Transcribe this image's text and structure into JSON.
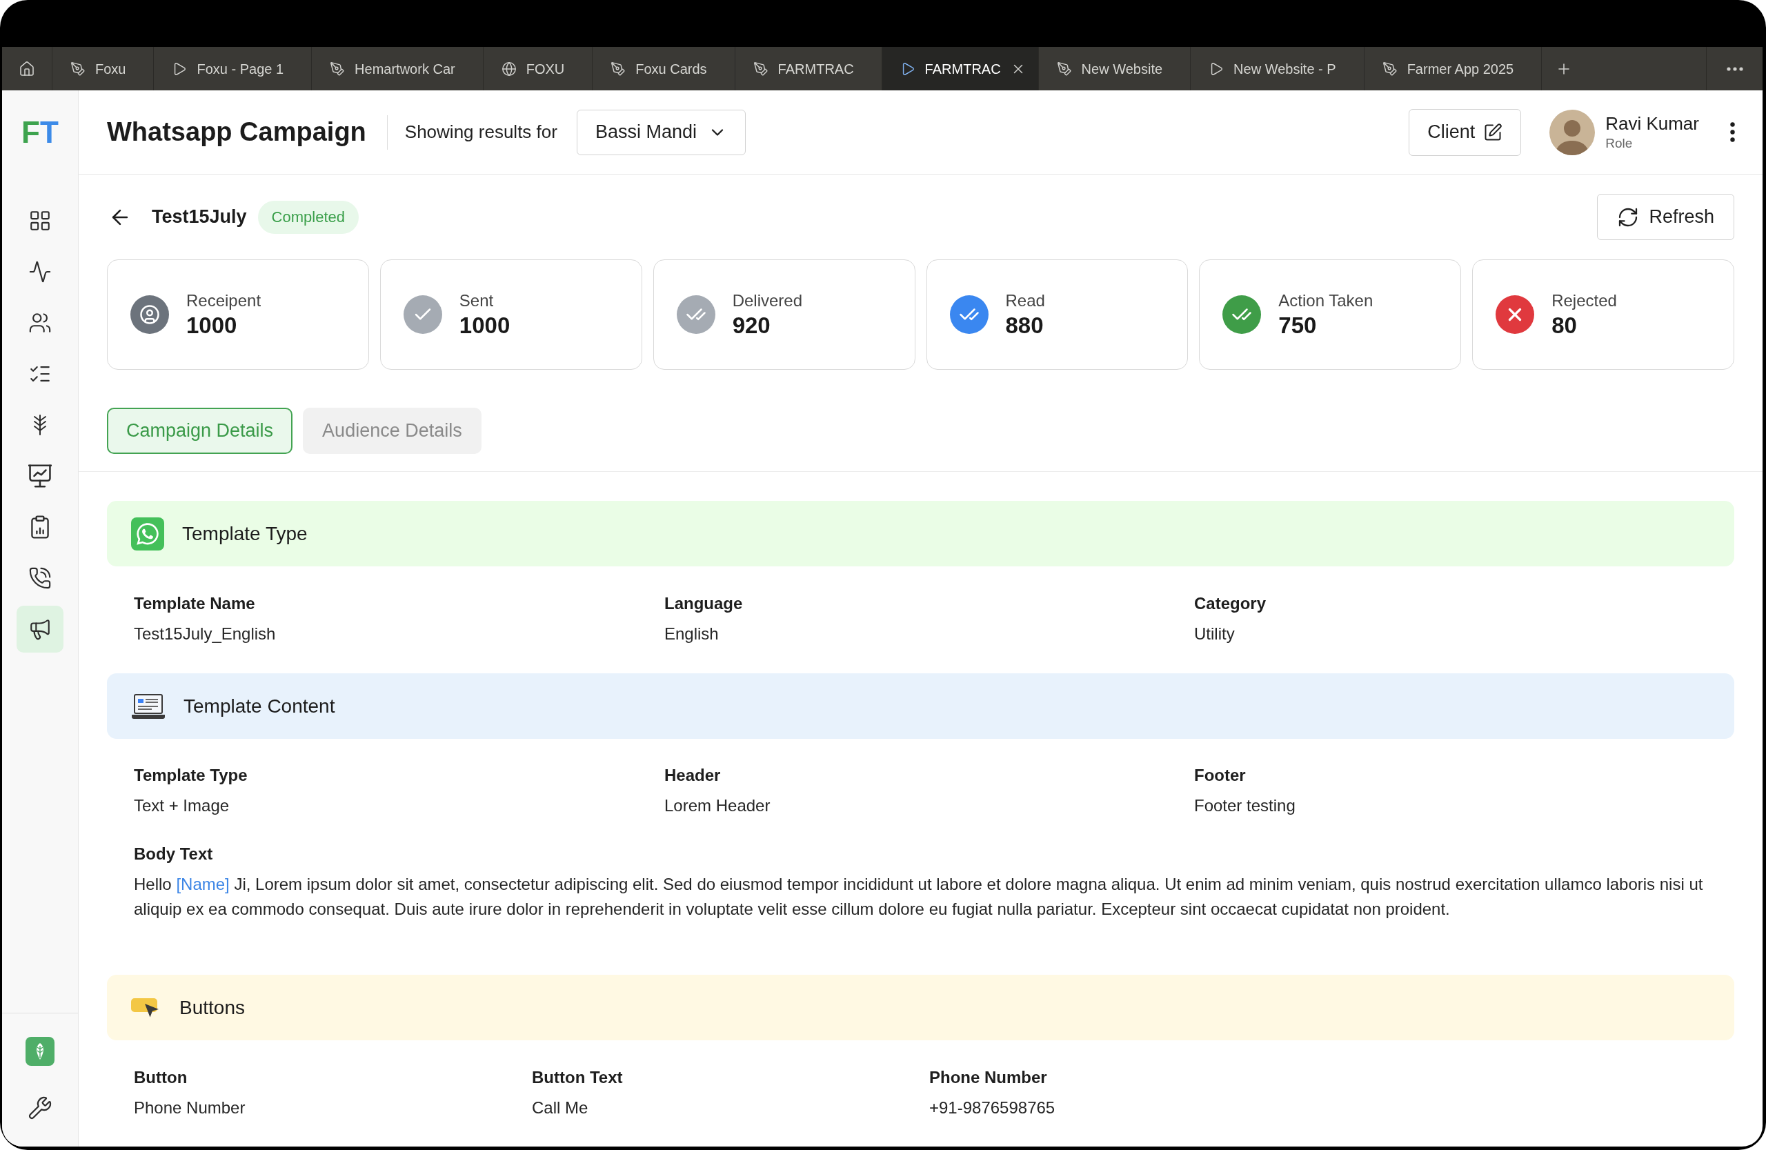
{
  "browser_tabs": [
    {
      "label": "Foxu",
      "kind": "design",
      "selected": false
    },
    {
      "label": "Foxu - Page 1",
      "kind": "prototype",
      "selected": false
    },
    {
      "label": "Hemartwork Car",
      "kind": "design",
      "selected": false
    },
    {
      "label": "FOXU",
      "kind": "site",
      "selected": false
    },
    {
      "label": "Foxu Cards",
      "kind": "design",
      "selected": false
    },
    {
      "label": "FARMTRAC",
      "kind": "design",
      "selected": false
    },
    {
      "label": "FARMTRAC",
      "kind": "prototype",
      "selected": true
    },
    {
      "label": "New Website",
      "kind": "design",
      "selected": false
    },
    {
      "label": "New Website - P",
      "kind": "prototype",
      "selected": false
    },
    {
      "label": "Farmer App 2025",
      "kind": "design",
      "selected": false
    }
  ],
  "sidebar": {
    "logo": [
      {
        "text": "F",
        "color": "#3ea34e"
      },
      {
        "text": "T",
        "color": "#3d8be8"
      }
    ],
    "items": [
      {
        "kind": "dashboard",
        "selected": false
      },
      {
        "kind": "activity",
        "selected": false
      },
      {
        "kind": "users",
        "selected": false
      },
      {
        "kind": "tasks",
        "selected": false
      },
      {
        "kind": "crops",
        "selected": false
      },
      {
        "kind": "reports",
        "selected": false
      },
      {
        "kind": "clipboard",
        "selected": false
      },
      {
        "kind": "calls",
        "selected": false
      },
      {
        "kind": "campaigns",
        "selected": true
      }
    ],
    "footer_items": [
      {
        "kind": "brand"
      },
      {
        "kind": "tools"
      }
    ]
  },
  "header": {
    "title": "Whatsapp Campaign",
    "filter_label": "Showing results for",
    "filter_value": "Bassi Mandi",
    "client_button": "Client",
    "user": {
      "name": "Ravi Kumar",
      "role": "Role"
    }
  },
  "campaign": {
    "name": "Test15July",
    "status": "Completed",
    "refresh_button": "Refresh"
  },
  "stats": [
    {
      "label": "Receipent",
      "value": "1000",
      "kind": "recipient",
      "color": "#6c737c"
    },
    {
      "label": "Sent",
      "value": "1000",
      "kind": "sent",
      "color": "#a5abb3"
    },
    {
      "label": "Delivered",
      "value": "920",
      "kind": "delivered",
      "color": "#a5abb3"
    },
    {
      "label": "Read",
      "value": "880",
      "kind": "read",
      "color": "#3a87f0"
    },
    {
      "label": "Action Taken",
      "value": "750",
      "kind": "action",
      "color": "#3f9d48"
    },
    {
      "label": "Rejected",
      "value": "80",
      "kind": "rejected",
      "color": "#e0393e"
    }
  ],
  "detail_tabs": [
    {
      "label": "Campaign Details",
      "selected": true
    },
    {
      "label": "Audience Details",
      "selected": false
    }
  ],
  "sections": [
    {
      "title": "Template Type",
      "kind": "template_type",
      "fields": [
        {
          "label": "Template Name",
          "value": "Test15July_English"
        },
        {
          "label": "Language",
          "value": "English"
        },
        {
          "label": "Category",
          "value": "Utility"
        }
      ]
    },
    {
      "title": "Template Content",
      "kind": "template_content",
      "fields": [
        {
          "label": "Template Type",
          "value": "Text + Image"
        },
        {
          "label": "Header",
          "value": "Lorem Header"
        },
        {
          "label": "Footer",
          "value": "Footer testing"
        }
      ],
      "body": {
        "label": "Body Text",
        "text_before": "Hello",
        "variable": "[Name]",
        "text_after": "Ji, Lorem ipsum dolor sit amet, consectetur adipiscing elit. Sed do eiusmod tempor incididunt ut labore et dolore magna aliqua. Ut enim ad minim veniam, quis nostrud exercitation ullamco laboris nisi ut aliquip ex ea commodo consequat. Duis aute irure dolor in reprehenderit in voluptate velit esse cillum dolore eu fugiat nulla pariatur. Excepteur sint occaecat cupidatat non proident."
      }
    },
    {
      "title": "Buttons",
      "kind": "buttons",
      "fields": [
        {
          "label": "Button",
          "value": "Phone Number"
        },
        {
          "label": "Button Text",
          "value": "Call Me"
        },
        {
          "label": "Phone Number",
          "value": "+91-9876598765"
        }
      ]
    }
  ]
}
